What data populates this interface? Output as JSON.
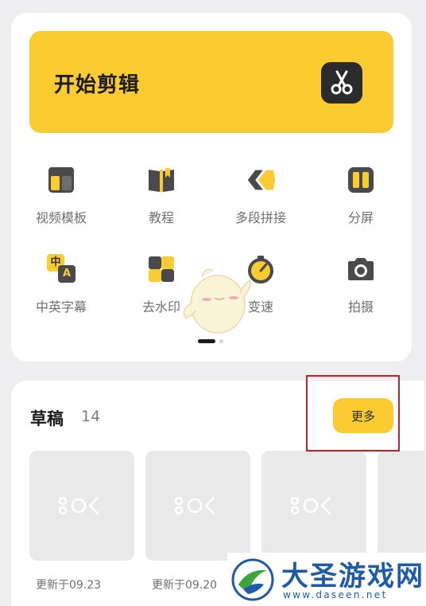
{
  "start": {
    "title": "开始剪辑",
    "icon": "scissors-icon"
  },
  "tools": [
    {
      "label": "视频模板",
      "icon": "template-icon"
    },
    {
      "label": "教程",
      "icon": "book-icon"
    },
    {
      "label": "多段拼接",
      "icon": "splice-icon"
    },
    {
      "label": "分屏",
      "icon": "split-screen-icon"
    },
    {
      "label": "中英字幕",
      "icon": "subtitle-icon",
      "badge_top": "中",
      "badge_bottom": "A"
    },
    {
      "label": "去水印",
      "icon": "remove-watermark-icon"
    },
    {
      "label": "变速",
      "icon": "speed-icon"
    },
    {
      "label": "拍摄",
      "icon": "camera-icon"
    }
  ],
  "pager": {
    "pages": 2,
    "current": 1
  },
  "drafts": {
    "title": "草稿",
    "count": "14",
    "more_label": "更多",
    "items": [
      {
        "date": "更新于09.23"
      },
      {
        "date": "更新于09.20"
      },
      {
        "date": ""
      },
      {
        "date": ""
      }
    ]
  },
  "watermark": {
    "name": "大圣游戏网",
    "url": "www.daseen.net"
  },
  "colors": {
    "accent": "#fbcb32",
    "dark": "#2b2b2d",
    "highlight": "#c81f27",
    "watermark": "#1e5aa8"
  }
}
